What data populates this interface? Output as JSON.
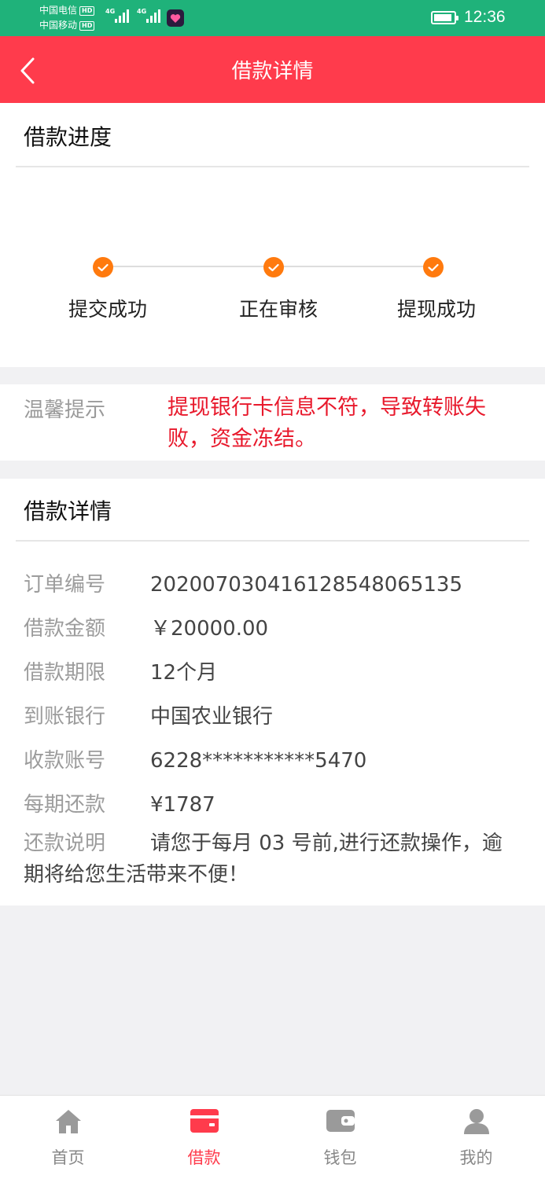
{
  "status_bar": {
    "carrier1": "中国电信",
    "carrier2": "中国移动",
    "hd": "HD",
    "net1": "4G",
    "net2": "4G",
    "time": "12:36"
  },
  "nav": {
    "title": "借款详情"
  },
  "progress": {
    "title": "借款进度",
    "steps": [
      {
        "label": "提交成功"
      },
      {
        "label": "正在审核"
      },
      {
        "label": "提现成功"
      }
    ]
  },
  "tip": {
    "label": "温馨提示",
    "text": "提现银行卡信息不符，导致转账失败，资金冻结。"
  },
  "details": {
    "title": "借款详情",
    "rows": [
      {
        "label": "订单编号",
        "value": "202007030416128548065135"
      },
      {
        "label": "借款金额",
        "value": "￥20000.00"
      },
      {
        "label": "借款期限",
        "value": "12个月"
      },
      {
        "label": "到账银行",
        "value": "中国农业银行"
      },
      {
        "label": "收款账号",
        "value": "6228***********5470"
      },
      {
        "label": "每期还款",
        "value": "¥1787"
      }
    ],
    "note_label": "还款说明",
    "note_text": "请您于每月 03 号前,进行还款操作，逾期将给您生活带来不便！"
  },
  "tabs": [
    {
      "label": "首页",
      "icon": "home-icon",
      "active": false
    },
    {
      "label": "借款",
      "icon": "card-icon",
      "active": true
    },
    {
      "label": "钱包",
      "icon": "wallet-icon",
      "active": false
    },
    {
      "label": "我的",
      "icon": "user-icon",
      "active": false
    }
  ],
  "colors": {
    "status_bar": "#1fb27a",
    "nav_bar": "#ff3b4c",
    "step_done": "#ff7a0e",
    "tip_text": "#e8192c",
    "tab_active": "#ff3b4c",
    "tab_inactive": "#888888"
  }
}
